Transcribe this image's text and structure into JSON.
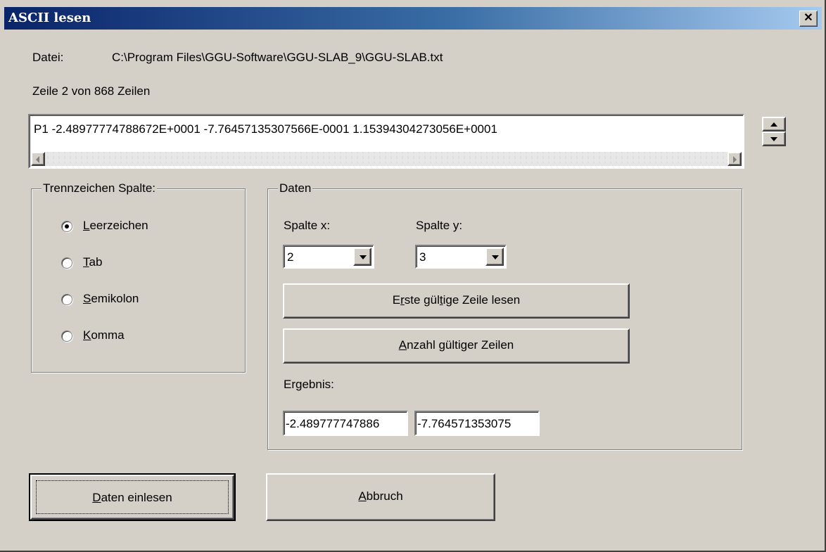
{
  "window": {
    "title": "ASCII lesen",
    "close_glyph": "✕"
  },
  "file": {
    "label": "Datei:",
    "path": "C:\\Program Files\\GGU-Software\\GGU-SLAB_9\\GGU-SLAB.txt"
  },
  "line_info": "Zeile 2 von 868 Zeilen",
  "preview": {
    "text": "P1 -2.48977774788672E+0001 -7.76457135307566E-0001  1.15394304273056E+0001"
  },
  "separator_group": {
    "title": "Trennzeichen Spalte:",
    "options": [
      {
        "mnemonic": "L",
        "rest": "eerzeichen",
        "selected": true
      },
      {
        "mnemonic": "T",
        "rest": "ab",
        "selected": false
      },
      {
        "mnemonic": "S",
        "rest": "emikolon",
        "selected": false
      },
      {
        "mnemonic": "K",
        "rest": "omma",
        "selected": false
      }
    ]
  },
  "data_group": {
    "title": "Daten",
    "col_x_label": "Spalte x:",
    "col_x_value": "2",
    "col_y_label": "Spalte y:",
    "col_y_value": "3",
    "first_line_btn": {
      "pre": "E",
      "mnemonic": "r",
      "mid": "ste gül",
      "mnemonic2": "t",
      "post": "ige Zeile lesen"
    },
    "count_btn": {
      "mnemonic": "A",
      "rest": "nzahl gültiger Zeilen"
    },
    "result_label": "Ergebnis:",
    "result_x": "-2.489777747886",
    "result_y": "-7.764571353075"
  },
  "buttons": {
    "read": {
      "mnemonic": "D",
      "rest": "aten einlesen"
    },
    "cancel": {
      "mnemonic": "A",
      "rest": "bbruch"
    }
  }
}
